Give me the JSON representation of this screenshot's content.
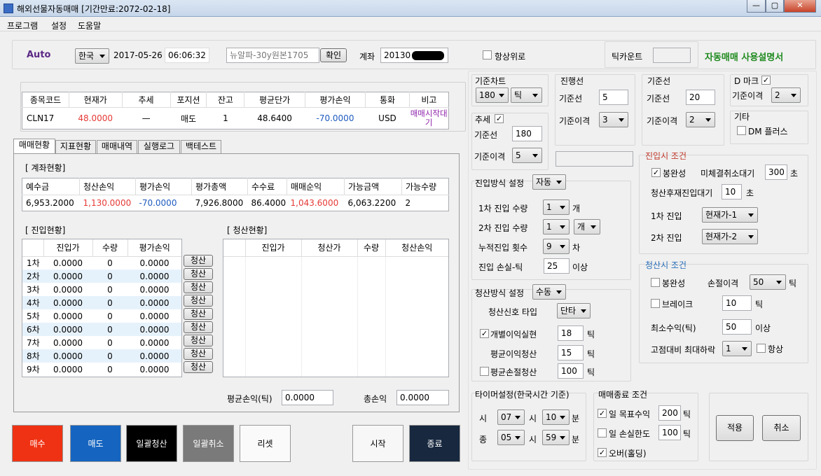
{
  "window": {
    "title": "해외선물자동매매 [기간만료:2072-02-18]",
    "min": "—",
    "max": "▢",
    "close": "✕"
  },
  "menu": [
    "프로그램",
    "설정",
    "도움말"
  ],
  "header": {
    "mode": "Auto",
    "language": "한국",
    "date": "2017-05-26",
    "time": "06:06:32",
    "product": "뉴알파-30y원본1705",
    "confirm": "확인",
    "account_label": "계좌",
    "account_value": "20130",
    "always_on_top": "항상위로",
    "tick_count_label": "틱카운트",
    "tick_count_value": "",
    "manual_link": "자동매매 사용설명서"
  },
  "position": {
    "headers": [
      "종목코드",
      "현재가",
      "추세",
      "포지션",
      "잔고",
      "평균단가",
      "평가손익",
      "통화",
      "비고"
    ],
    "row": [
      "CLN17",
      "48.0000",
      "—",
      "매도",
      "1",
      "48.6400",
      "-70.0000",
      "USD",
      "매매시작대기"
    ]
  },
  "tabs": [
    "매매현황",
    "지표현황",
    "매매내역",
    "실행로그",
    "백테스트"
  ],
  "account": {
    "title": "[ 계좌현황]",
    "headers": [
      "예수금",
      "청산손익",
      "평가손익",
      "평가총액",
      "수수료",
      "매매순익",
      "가능금액",
      "가능수량"
    ],
    "row": [
      "6,953.2000",
      "1,130.0000",
      "-70.0000",
      "7,926.8000",
      "86.4000",
      "1,043.6000",
      "6,063.2200",
      "2"
    ]
  },
  "entry": {
    "title": "[ 진입현황]",
    "headers": [
      "",
      "진입가",
      "수량",
      "평가손익"
    ],
    "rows": [
      [
        "1차",
        "0.0000",
        "0",
        "0.0000"
      ],
      [
        "2차",
        "0.0000",
        "0",
        "0.0000"
      ],
      [
        "3차",
        "0.0000",
        "0",
        "0.0000"
      ],
      [
        "4차",
        "0.0000",
        "0",
        "0.0000"
      ],
      [
        "5차",
        "0.0000",
        "0",
        "0.0000"
      ],
      [
        "6차",
        "0.0000",
        "0",
        "0.0000"
      ],
      [
        "7차",
        "0.0000",
        "0",
        "0.0000"
      ],
      [
        "8차",
        "0.0000",
        "0",
        "0.0000"
      ],
      [
        "9차",
        "0.0000",
        "0",
        "0.0000"
      ]
    ],
    "clear_label": "청산"
  },
  "clear": {
    "title": "[ 청산현황]",
    "headers": [
      "",
      "진입가",
      "청산가",
      "수량",
      "청산손익"
    ]
  },
  "totals": {
    "avg_label": "평균손익(틱)",
    "avg_value": "0.0000",
    "total_label": "총손익",
    "total_value": "0.0000"
  },
  "bottom_buttons": {
    "buy": "매수",
    "sell": "매도",
    "clear_all": "일괄청산",
    "cancel_all": "일괄취소",
    "reset": "리셋",
    "start": "시작",
    "stop": "종료"
  },
  "settings": {
    "base_chart": {
      "title": "기준차트",
      "value": "180",
      "unit": "틱"
    },
    "trend": {
      "title": "추세",
      "base_label": "기준선",
      "base_value": "180",
      "gap_label": "기준이격",
      "gap_value": "5"
    },
    "progress": {
      "title": "진행선",
      "base_label": "기준선",
      "base_value": "5",
      "gap_label": "기준이격",
      "gap_value": "3"
    },
    "baseline": {
      "title": "기준선",
      "base_label": "기준선",
      "base_value": "20",
      "gap_label": "기준이격",
      "gap_value": "2"
    },
    "dmark": {
      "title": "D 마크",
      "gap_label": "기준이격",
      "gap_value": "2"
    },
    "etc": {
      "title": "기타",
      "dm_plus": "DM 플러스"
    },
    "entry_method": {
      "title": "진입방식 설정",
      "value": "자동",
      "qty1_label": "1차 진입 수량",
      "qty1": "1",
      "qty1_unit": "개",
      "qty2_label": "2차 진입 수량",
      "qty2": "1",
      "qty2_unit": "개",
      "count_label": "누적진입 횟수",
      "count": "9",
      "count_unit": "차",
      "loss_label": "진입 손실-틱",
      "loss": "25",
      "loss_unit": "이상"
    },
    "clear_method": {
      "title": "청산방식 설정",
      "value": "수동",
      "signal_label": "청산신호 타입",
      "signal": "단타",
      "indiv_label": "개별이익실현",
      "indiv": "18",
      "unit": "틱",
      "avg_label": "평균이익청산",
      "avg": "15",
      "avgloss_label": "평균손절청산",
      "avgloss": "100"
    },
    "entry_cond": {
      "title": "진입시 조건",
      "candle_label": "봉완성",
      "unfilled_label": "미체결취소대기",
      "unfilled": "300",
      "sec": "초",
      "after_label": "청산후재진입대기",
      "after": "10",
      "first_label": "1차 진입",
      "first": "현재가-1",
      "second_label": "2차 진입",
      "second": "현재가-2"
    },
    "clear_cond": {
      "title": "청산시 조건",
      "candle_label": "봉완성",
      "loss_gap_label": "손절이격",
      "loss_gap": "50",
      "tick": "틱",
      "brake_label": "브레이크",
      "brake": "10",
      "minprofit_label": "최소수익(틱)",
      "minprofit": "50",
      "over": "이상",
      "drop_label": "고점대비 최대하락",
      "drop": "1",
      "always_label": "항상"
    },
    "timer": {
      "title": "타이머설정(한국시간 기준)",
      "start_label": "시",
      "start_h": "07",
      "start_m": "10",
      "end_label": "종",
      "end_h": "05",
      "end_m": "59",
      "h_unit": "시",
      "m_unit": "분"
    },
    "end_cond": {
      "title": "매매종료 조건",
      "target_label": "일 목표수익",
      "target": "200",
      "loss_label": "일 손실한도",
      "loss": "100",
      "overnight_label": "오버(홀딩)",
      "tick": "틱"
    },
    "apply": "적용",
    "cancel": "취소"
  },
  "colors": {
    "buy": "#f03214",
    "sell": "#1565c0",
    "red_text": "#e53935",
    "blue_text": "#1e5bbf",
    "purple_text": "#8e24aa",
    "green_link": "#1f8a1f",
    "navy": "#17283f"
  }
}
